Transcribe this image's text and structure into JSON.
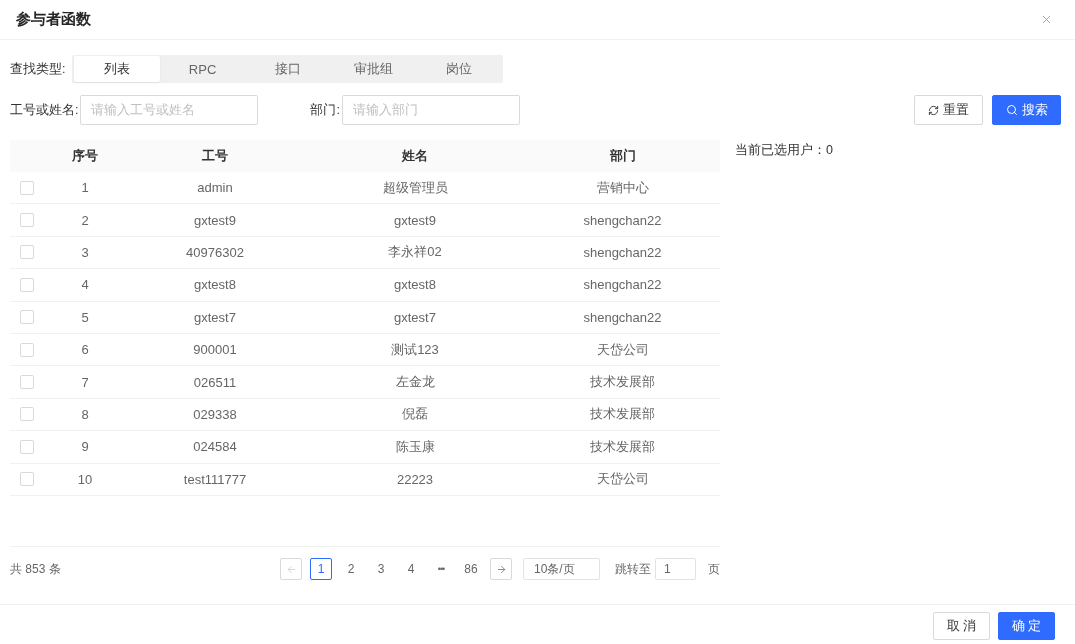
{
  "dialog": {
    "title": "参与者函数"
  },
  "search_type": {
    "label": "查找类型:",
    "options": [
      {
        "label": "列表",
        "selected": true
      },
      {
        "label": "RPC",
        "selected": false
      },
      {
        "label": "接口",
        "selected": false
      },
      {
        "label": "审批组",
        "selected": false
      },
      {
        "label": "岗位",
        "selected": false
      }
    ]
  },
  "filters": [
    {
      "label": "工号或姓名:",
      "placeholder": "请输入工号或姓名"
    },
    {
      "label": "部门:",
      "placeholder": "请输入部门"
    }
  ],
  "actions": [
    {
      "label": "重置",
      "kind": "reset"
    },
    {
      "label": "搜索",
      "kind": "search"
    }
  ],
  "table": {
    "columns": [
      "序号",
      "工号",
      "姓名",
      "部门"
    ],
    "rows": [
      {
        "checked": false,
        "cells": [
          "1",
          "admin",
          "超级管理员",
          "营销中心"
        ]
      },
      {
        "checked": false,
        "cells": [
          "2",
          "gxtest9",
          "gxtest9",
          "shengchan22"
        ]
      },
      {
        "checked": false,
        "cells": [
          "3",
          "40976302",
          "李永祥02",
          "shengchan22"
        ]
      },
      {
        "checked": false,
        "cells": [
          "4",
          "gxtest8",
          "gxtest8",
          "shengchan22"
        ]
      },
      {
        "checked": false,
        "cells": [
          "5",
          "gxtest7",
          "gxtest7",
          "shengchan22"
        ]
      },
      {
        "checked": false,
        "cells": [
          "6",
          "900001",
          "测试123",
          "天岱公司"
        ]
      },
      {
        "checked": false,
        "cells": [
          "7",
          "026511",
          "左金龙",
          "技术发展部"
        ]
      },
      {
        "checked": false,
        "cells": [
          "8",
          "029338",
          "倪磊",
          "技术发展部"
        ]
      },
      {
        "checked": false,
        "cells": [
          "9",
          "024584",
          "陈玉康",
          "技术发展部"
        ]
      },
      {
        "checked": false,
        "cells": [
          "10",
          "test111777",
          "22223",
          "天岱公司"
        ]
      }
    ]
  },
  "selected_users": "当前已选用户：0",
  "pagination": {
    "total": "共 853 条",
    "prev": {
      "disabled": true
    },
    "pages": [
      {
        "label": "1",
        "kind": "page",
        "selected": true
      },
      {
        "label": "2",
        "kind": "page",
        "selected": false
      },
      {
        "label": "3",
        "kind": "page",
        "selected": false
      },
      {
        "label": "4",
        "kind": "page",
        "selected": false
      },
      {
        "label": "•••",
        "kind": "ellipsis",
        "selected": false
      },
      {
        "label": "86",
        "kind": "page",
        "selected": false
      }
    ],
    "next": {
      "disabled": false
    },
    "page_size": "10条/页",
    "jump": {
      "label": "跳转至",
      "value": "1",
      "suffix": "页"
    }
  },
  "footer": {
    "buttons": [
      {
        "label": "取 消",
        "kind": "default"
      },
      {
        "label": "确 定",
        "kind": "primary"
      }
    ]
  }
}
